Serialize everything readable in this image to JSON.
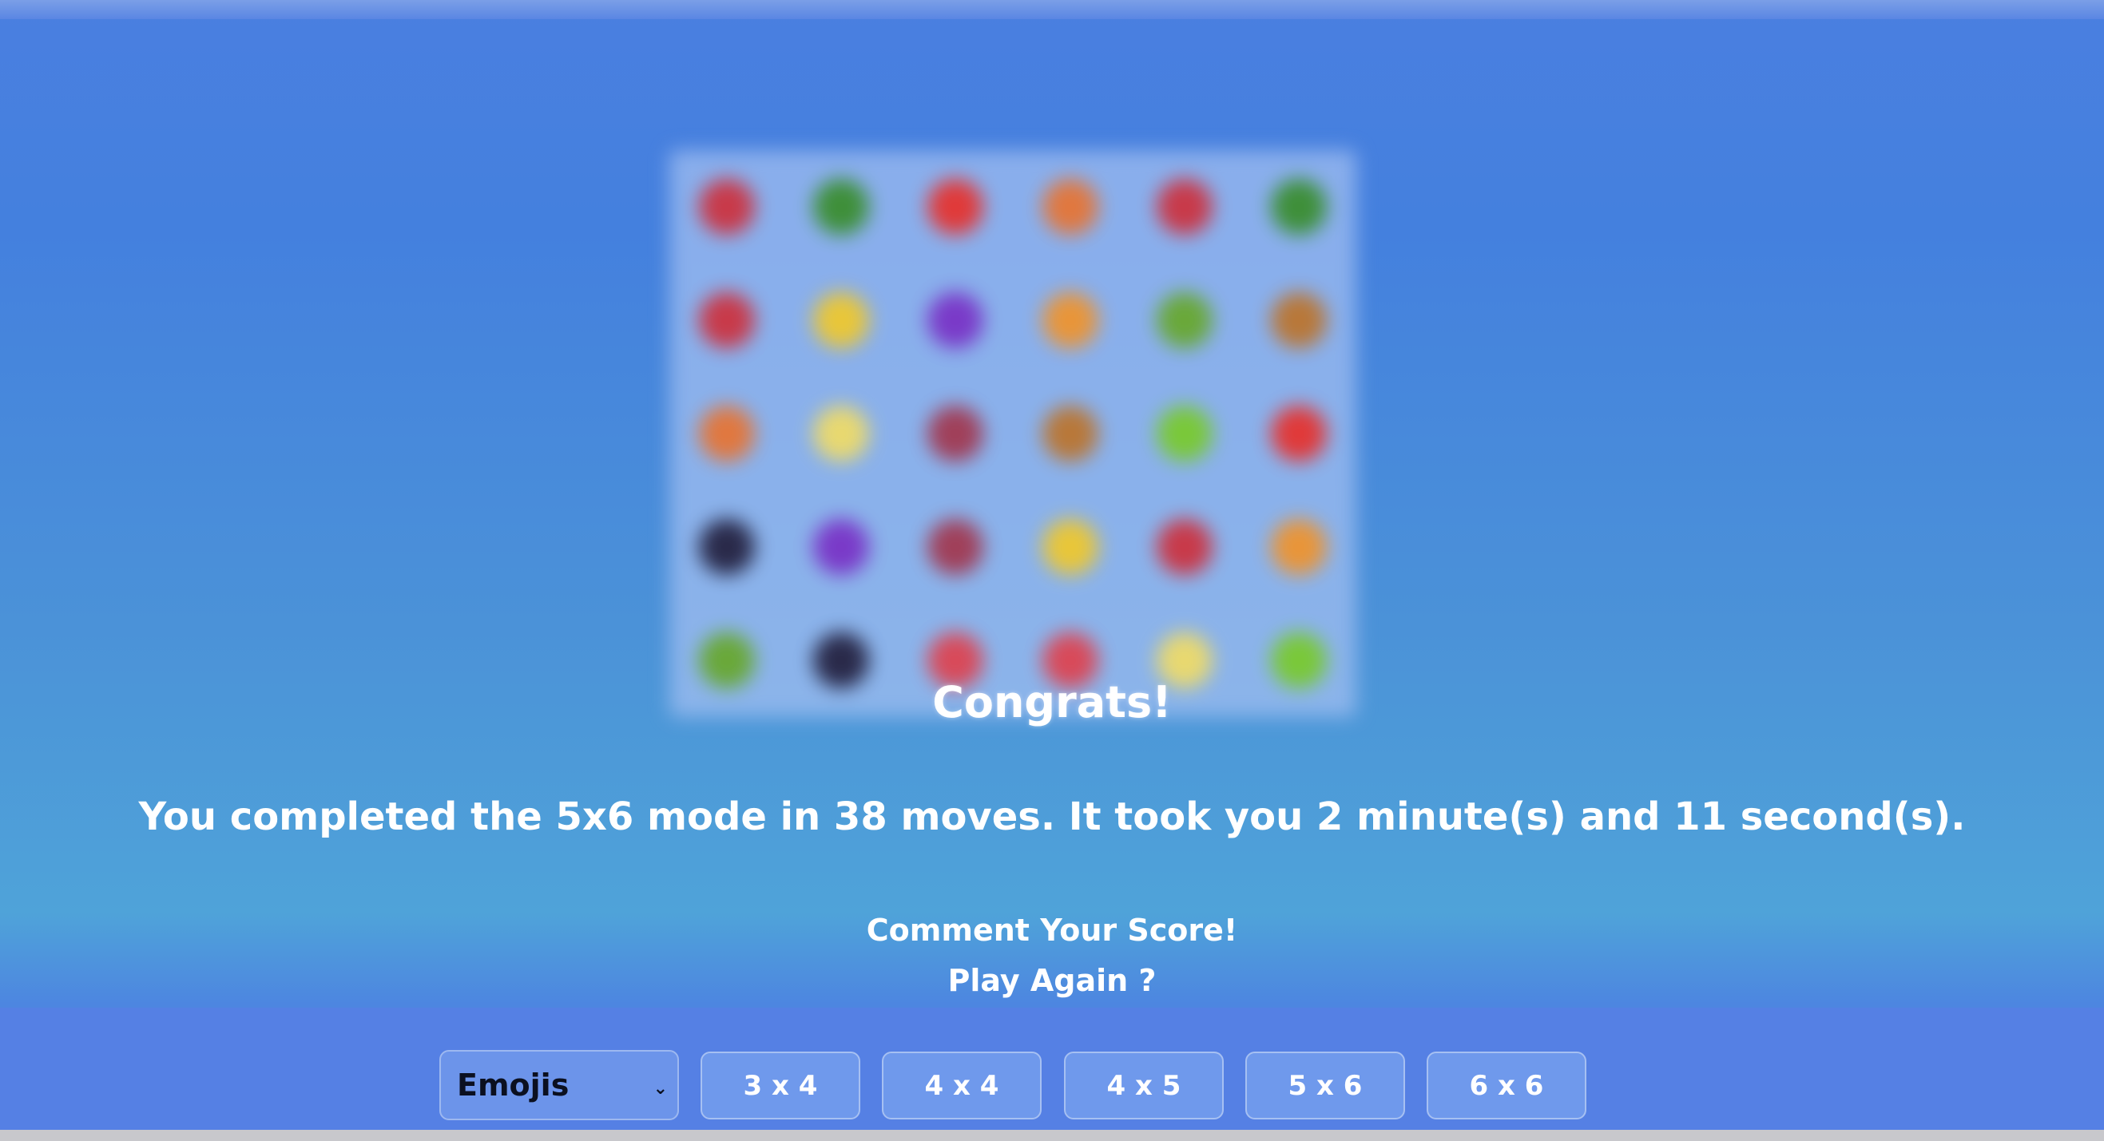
{
  "overlay": {
    "title": "Congrats!",
    "message": "You completed the 5x6 mode in 38 moves. It took you 2 minute(s) and 11 second(s).",
    "comment_label": "Comment Your Score!",
    "play_again_label": "Play Again ?"
  },
  "controls": {
    "theme_selected": "Emojis",
    "grid_sizes": [
      "3 x 4",
      "4 x 4",
      "4 x 5",
      "5 x 6",
      "6 x 6"
    ]
  },
  "board": {
    "rows": 5,
    "cols": 6,
    "tile_colors": [
      [
        "#c83a4a",
        "#3f8f3a",
        "#e03a3a",
        "#e07840",
        "#c83a4a",
        "#3f8f3a"
      ],
      [
        "#c83a4a",
        "#e8c63a",
        "#7a3ac8",
        "#e8953a",
        "#6aa83a",
        "#b8783a"
      ],
      [
        "#e07840",
        "#e8d870",
        "#a0405a",
        "#b8783a",
        "#7ac83a",
        "#e03a3a"
      ],
      [
        "#2a2a4a",
        "#7a3ac8",
        "#a0405a",
        "#e8c63a",
        "#c83a4a",
        "#e8953a"
      ],
      [
        "#6aa83a",
        "#2a2a4a",
        "#d84a5a",
        "#d84a5a",
        "#e8d870",
        "#7ac83a"
      ]
    ]
  }
}
